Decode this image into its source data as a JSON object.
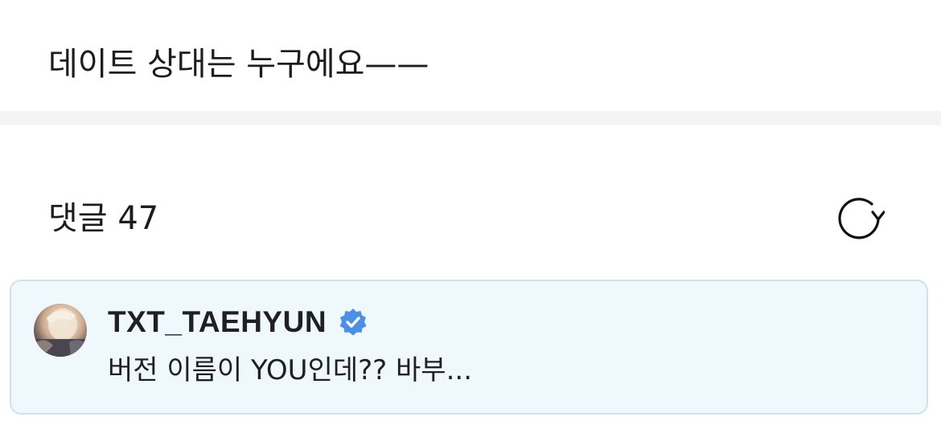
{
  "post": {
    "text": "데이트 상대는 누구에요——"
  },
  "comments": {
    "header": "댓글 47",
    "refresh_icon": "refresh-icon",
    "items": [
      {
        "author": "TXT_TAEHYUN",
        "verified": true,
        "verified_icon": "verified-badge-icon",
        "text": "버전 이름이 YOU인데?? 바부...",
        "highlight_color": "#eef8fd"
      }
    ]
  },
  "colors": {
    "verified_blue": "#4d8fe6",
    "card_border": "#cfe2ee",
    "divider": "#f4f4f7"
  }
}
